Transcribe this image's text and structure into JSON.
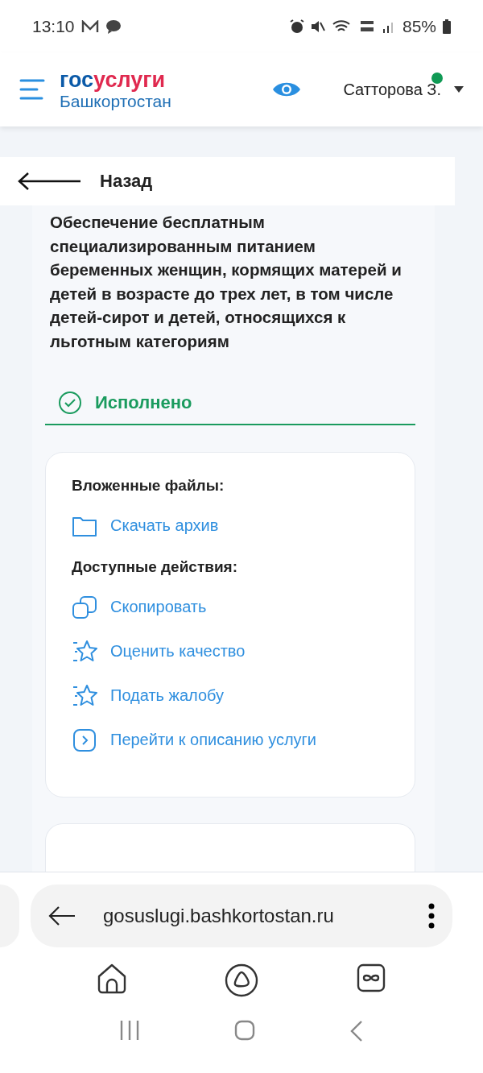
{
  "status_bar": {
    "time": "13:10",
    "battery": "85%"
  },
  "header": {
    "logo_top_a": "гос",
    "logo_top_b": "услуги",
    "logo_bottom": "Башкортостан",
    "user": "Сатторова З.",
    "online": true
  },
  "back": {
    "label": "Назад"
  },
  "service": {
    "title": "Обеспечение бесплатным специализированным питанием беременных женщин, кормящих матерей и детей в возрасте до трех лет, в том числе детей-сирот и детей, относящихся к льготным категориям",
    "status": {
      "kind": "done",
      "label": "Исполнено"
    }
  },
  "files": {
    "heading": "Вложенные файлы:",
    "items": [
      {
        "kind": "folder",
        "label": "Скачать архив"
      }
    ]
  },
  "actions": {
    "heading": "Доступные действия:",
    "items": [
      {
        "kind": "copy",
        "label": "Скопировать"
      },
      {
        "kind": "star",
        "label": "Оценить качество"
      },
      {
        "kind": "star",
        "label": "Подать жалобу"
      },
      {
        "kind": "chevron",
        "label": "Перейти к описанию услуги"
      }
    ]
  },
  "browser": {
    "url": "gosuslugi.bashkortostan.ru"
  }
}
